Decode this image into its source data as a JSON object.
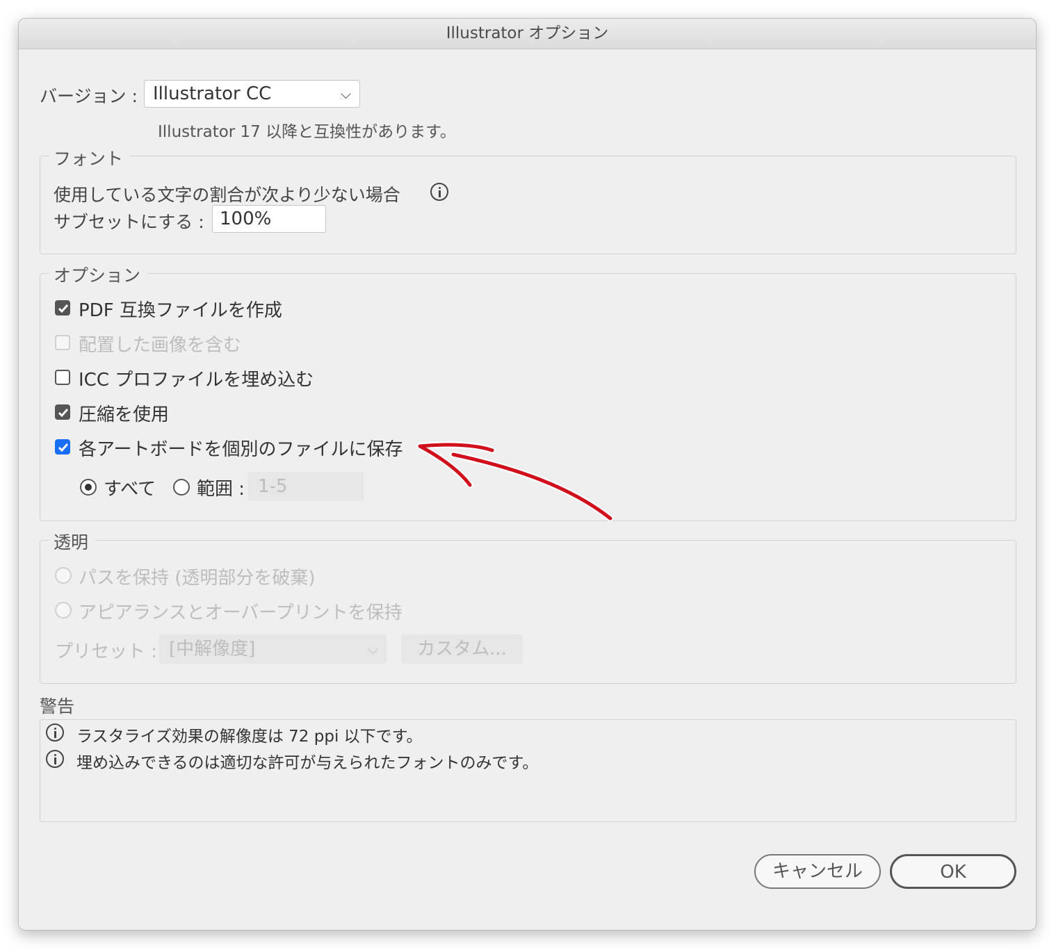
{
  "window": {
    "title": "Illustrator オプション"
  },
  "version": {
    "label": "バージョン :",
    "selected": "Illustrator CC",
    "compat_note": "Illustrator 17 以降と互換性があります。"
  },
  "fonts": {
    "legend": "フォント",
    "subset_line1": "使用している文字の割合が次より少ない場合",
    "subset_label": "サブセットにする :",
    "subset_value": "100%"
  },
  "options": {
    "legend": "オプション",
    "items": [
      {
        "label": "PDF 互換ファイルを作成",
        "checked": true,
        "enabled": true
      },
      {
        "label": "配置した画像を含む",
        "checked": false,
        "enabled": false
      },
      {
        "label": "ICC プロファイルを埋め込む",
        "checked": false,
        "enabled": true
      },
      {
        "label": "圧縮を使用",
        "checked": true,
        "enabled": true
      },
      {
        "label": "各アートボードを個別のファイルに保存",
        "checked": true,
        "enabled": true
      }
    ],
    "artboards": {
      "all_label": "すべて",
      "range_label": "範囲 :",
      "range_placeholder": "1-5",
      "selected": "all"
    }
  },
  "transparency": {
    "legend": "透明",
    "radio_paths": "パスを保持 (透明部分を破棄)",
    "radio_appearance": "アピアランスとオーバープリントを保持",
    "preset_label": "プリセット :",
    "preset_value": "[中解像度]",
    "custom_button": "カスタム..."
  },
  "warnings": {
    "label": "警告",
    "items": [
      "ラスタライズ効果の解像度は 72 ppi 以下です。",
      "埋め込みできるのは適切な許可が与えられたフォントのみです。"
    ]
  },
  "buttons": {
    "cancel": "キャンセル",
    "ok": "OK"
  },
  "colors": {
    "annotation_arrow": "#d0101b",
    "checkbox_accent": "#1a6ef5"
  }
}
